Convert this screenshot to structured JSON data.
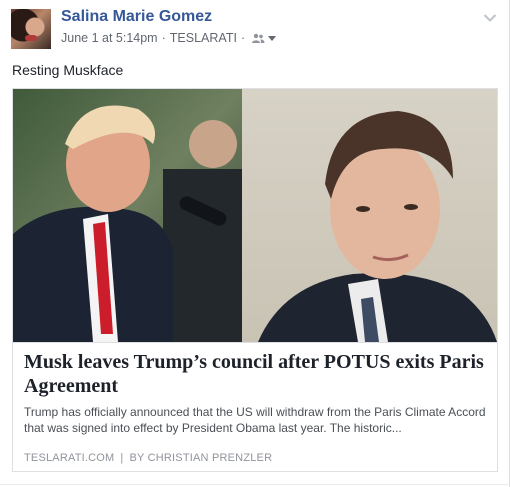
{
  "post": {
    "author": "Salina Marie Gomez",
    "timestamp": "June 1 at 5:14pm",
    "separator": "·",
    "via": "TESLARATI",
    "audience_icon": "friends-icon",
    "menu_icon": "chevron-down-icon",
    "text": "Resting Muskface"
  },
  "link": {
    "title": "Musk leaves Trump’s council after POTUS exits Paris Agreement",
    "description": "Trump has officially announced that the US will withdraw from the Paris Climate Accord that was signed into effect by President Obama last year. The historic...",
    "domain": "TESLARATI.COM",
    "source_separator": "|",
    "byline": "BY CHRISTIAN PRENZLER"
  },
  "colors": {
    "name_link": "#365899",
    "meta_text": "#616770",
    "border": "#dddfe2"
  }
}
